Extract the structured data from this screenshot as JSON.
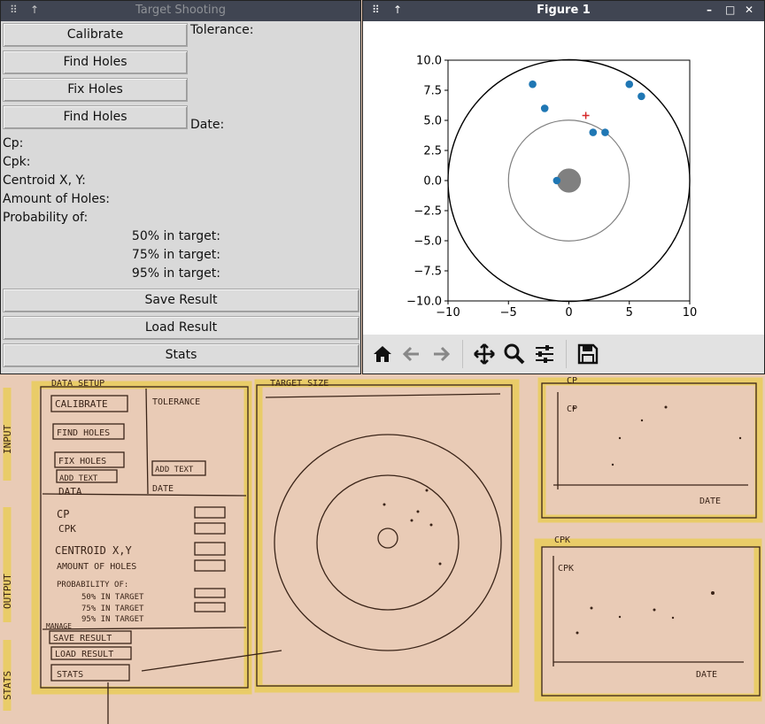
{
  "left_window": {
    "title": "Target Shooting",
    "buttons": {
      "calibrate": "Calibrate",
      "find_holes_1": "Find Holes",
      "fix_holes": "Fix Holes",
      "find_holes_2": "Find Holes",
      "save": "Save Result",
      "load": "Load Result",
      "stats": "Stats"
    },
    "labels": {
      "tolerance": "Tolerance:",
      "date": "Date:",
      "cp": "Cp:",
      "cpk": "Cpk:",
      "centroid": "Centroid X, Y:",
      "amount": "Amount of Holes:",
      "probability": "Probability of:",
      "p50": "50% in target:",
      "p75": "75% in target:",
      "p95": "95% in target:"
    }
  },
  "right_window": {
    "title": "Figure 1",
    "toolbar": [
      "home-icon",
      "back-icon",
      "forward-icon",
      "pan-icon",
      "zoom-icon",
      "configure-icon",
      "save-icon"
    ]
  },
  "chart_data": {
    "type": "scatter",
    "xlim": [
      -10,
      10
    ],
    "ylim": [
      -10,
      10
    ],
    "xticks": [
      "−10",
      "−5",
      "0",
      "5",
      "10"
    ],
    "yticks": [
      "10.0",
      "7.5",
      "5.0",
      "2.5",
      "0.0",
      "−2.5",
      "−5.0",
      "−7.5",
      "−10.0"
    ],
    "ytick_values": [
      10,
      7.5,
      5,
      2.5,
      0,
      -2.5,
      -5,
      -7.5,
      -10
    ],
    "xtick_values": [
      -10,
      -5,
      0,
      5,
      10
    ],
    "points": [
      [
        -3,
        8
      ],
      [
        -2,
        6
      ],
      [
        5,
        8
      ],
      [
        6,
        7
      ],
      [
        2,
        4
      ],
      [
        3,
        4
      ],
      [
        -1,
        0
      ]
    ],
    "point_color": "#1f77b4",
    "centroid": [
      1.4,
      5.4
    ],
    "centroid_color": "#d62728",
    "circles": [
      {
        "r": 10,
        "color": "#000000"
      },
      {
        "r": 5,
        "color": "#808080"
      }
    ],
    "bullseye_radius": 1,
    "bullseye_color": "#808080"
  },
  "sketch": {
    "side_labels": [
      "INPUT",
      "OUTPUT",
      "STATS"
    ],
    "headers": [
      "DATA SETUP",
      "TARGET SIZE",
      "CP",
      "CPK"
    ],
    "buttons": [
      "CALIBRATE",
      "FIND HOLES",
      "FIX HOLES",
      "ADD TEXT",
      "ADD TEXT",
      "SAVE RESULT",
      "LOAD RESULT",
      "STATS"
    ],
    "labels": [
      "TOLERANCE",
      "DATE",
      "DATA",
      "CP",
      "CPK",
      "CENTROID X,Y",
      "AMOUNT OF HOLES",
      "PROBABILITY OF:",
      "50% IN TARGET",
      "75% IN TARGET",
      "95% IN TARGET",
      "MANAGE",
      "DATE",
      "DATE",
      "CP",
      "CPK"
    ]
  }
}
